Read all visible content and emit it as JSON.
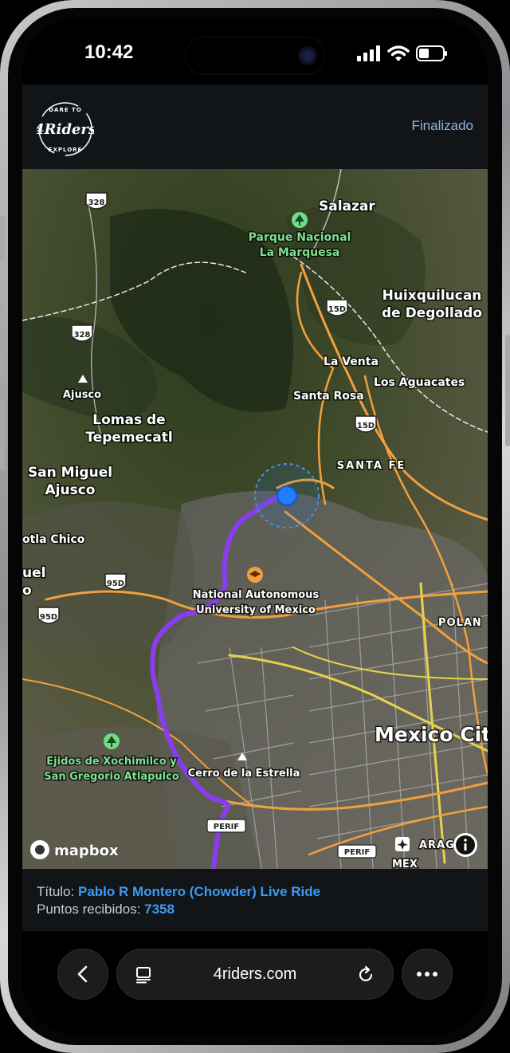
{
  "status_bar": {
    "time": "10:42"
  },
  "header": {
    "logo_text": "4Riders",
    "logo_tagline_top": "DARE TO",
    "logo_tagline_bottom": "EXPLORE",
    "status_label": "Finalizado"
  },
  "map": {
    "attribution": "mapbox",
    "places": {
      "salazar": "Salazar",
      "parque_1": "Parque Nacional",
      "parque_2": "La Marquesa",
      "huix_1": "Huixquilucan",
      "huix_2": "de Degollado",
      "la_venta": "La Venta",
      "los_aguacates": "Los Aguacates",
      "santa_rosa": "Santa Rosa",
      "ajusco": "Ajusco",
      "lomas_1": "Lomas de",
      "lomas_2": "Tepemecatl",
      "santa_fe": "SANTA FE",
      "san_miguel_1": "San Miguel",
      "san_miguel_2": "Ajusco",
      "tla_chico": "otla Chico",
      "uel": "uel",
      "o": "o",
      "unam_1": "National Autonomous",
      "unam_2": "University of Mexico",
      "polan": "POLAN",
      "mexico_city": "Mexico City",
      "ejidos_1": "Ejidos de Xochimilco y",
      "ejidos_2": "San Gregorio Atlapulco",
      "cerro": "Cerro de la Estrella",
      "arag": "ARAG",
      "mex": "MEX"
    },
    "shields": {
      "s328a": "328",
      "s328b": "328",
      "s15d_a": "15D",
      "s15d_b": "15D",
      "s95d_a": "95D",
      "s95d_b": "95D",
      "perif_a": "PERIF",
      "perif_b": "PERIF"
    },
    "colors": {
      "route": "#8a3df0",
      "location": "#1f7fff",
      "major_road": "#f2a03d",
      "yellow_road": "#e6d24a"
    }
  },
  "ride": {
    "title_label": "Título:",
    "title_value": "Pablo R Montero (Chowder) Live Ride",
    "points_label": "Puntos recibidos:",
    "points_value": "7358"
  },
  "browser": {
    "url": "4riders.com",
    "back_icon": "chevron-left-icon",
    "tabs_icon": "tabs-icon",
    "reload_icon": "reload-icon",
    "more_icon": "more-icon"
  }
}
